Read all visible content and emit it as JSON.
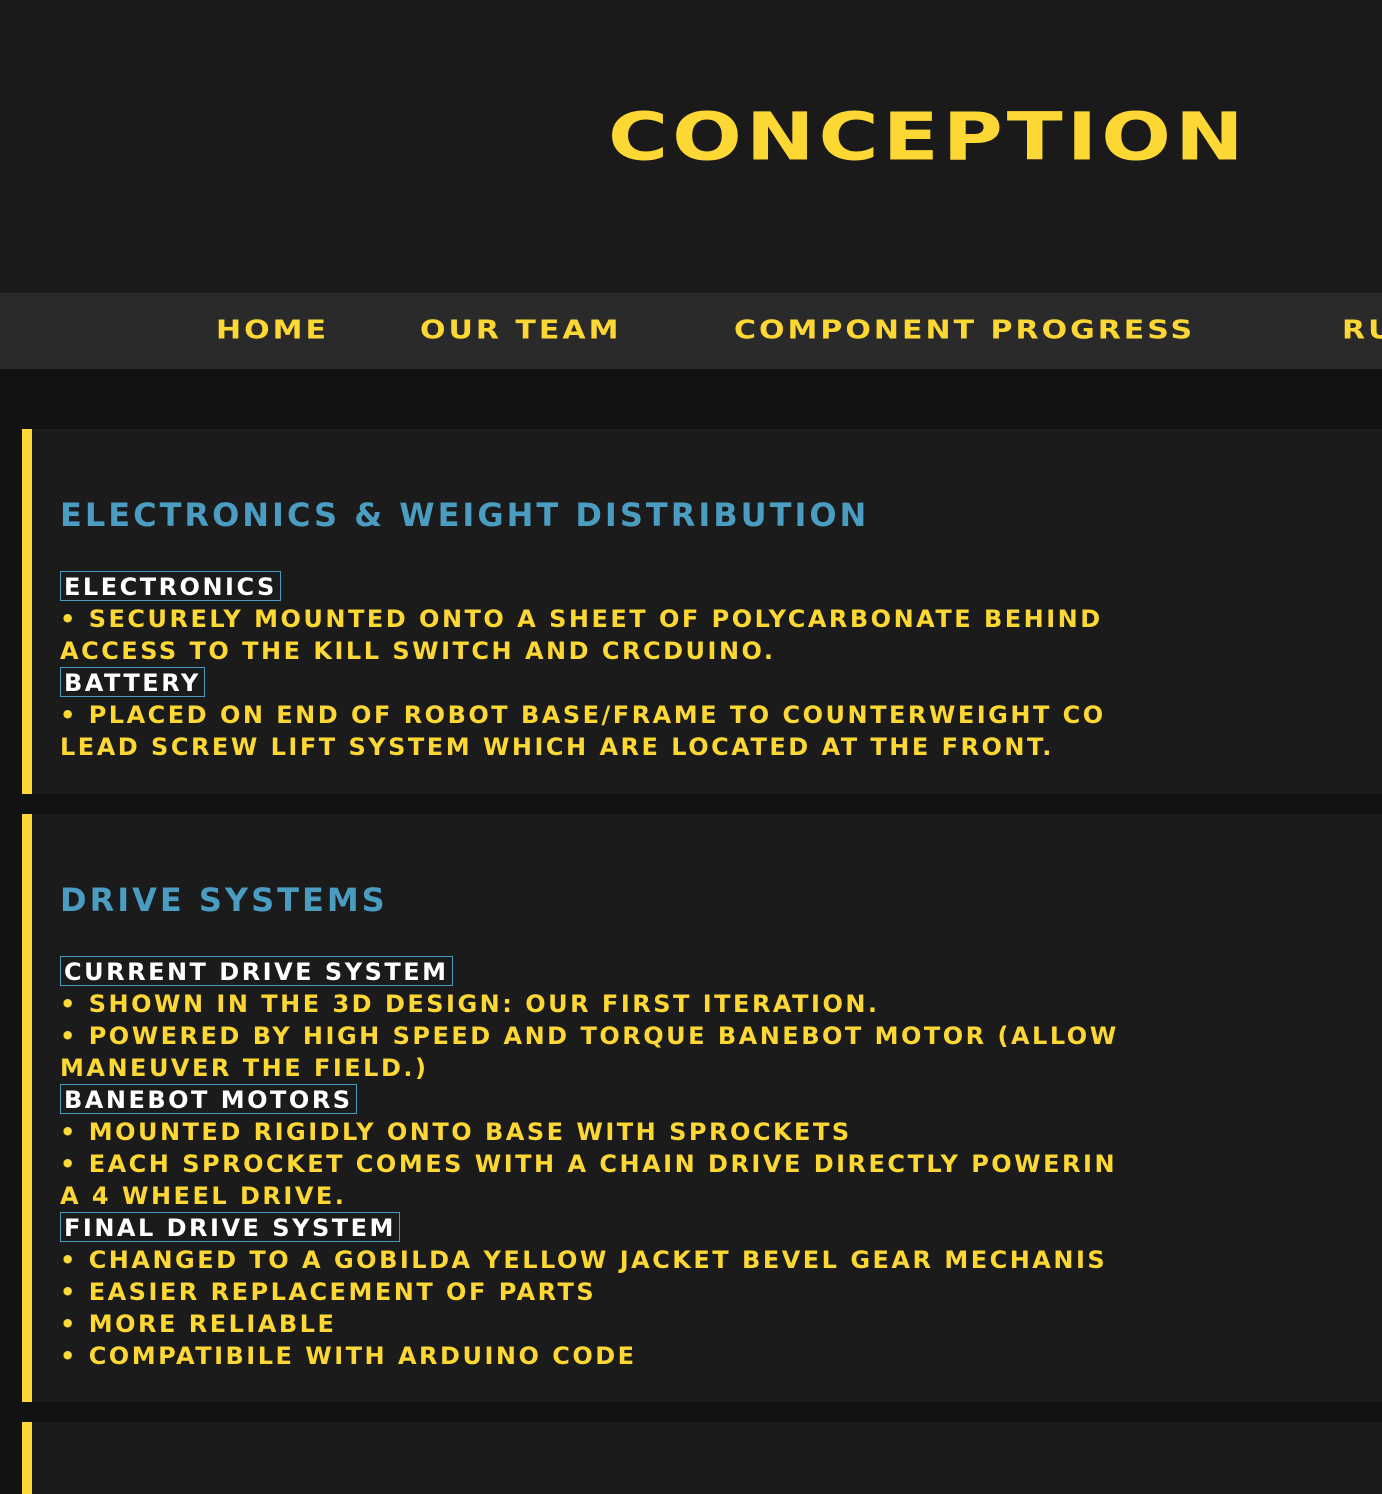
{
  "header": {
    "title": "Conception"
  },
  "nav": {
    "items": [
      {
        "label": "Home"
      },
      {
        "label": "Our Team"
      },
      {
        "label": "Component Progress"
      },
      {
        "label": "Ru"
      }
    ]
  },
  "sections": [
    {
      "title": "Electronics & Weight Distribution",
      "blocks": [
        {
          "label": "Electronics",
          "lines": [
            "• Securely mounted onto a sheet of polycarbonate behind",
            "access to the kill switch and CRCduino."
          ]
        },
        {
          "label": "Battery",
          "lines": [
            "• Placed on end of robot base/frame to counterweight co",
            "lead screw lift system which are located at the front."
          ]
        }
      ]
    },
    {
      "title": "Drive Systems",
      "blocks": [
        {
          "label": "Current Drive System",
          "lines": [
            "• Shown in the 3D design: our first iteration.",
            "• Powered by high speed and torque Banebot motor (allow",
            "maneuver the field.)"
          ]
        },
        {
          "label": "Banebot Motors",
          "lines": [
            "• Mounted rigidly onto base with sprockets",
            "• Each sprocket comes with a chain drive directly powerin",
            "a 4 wheel drive."
          ]
        },
        {
          "label": "Final Drive System",
          "lines": [
            "• Changed to a GoBilda Yellow Jacket Bevel Gear Mechanis",
            "• Easier replacement of parts",
            "• More reliable",
            "• Compatibile with Arduino code"
          ]
        }
      ]
    }
  ],
  "colors": {
    "accent_yellow": "#fdd835",
    "heading_blue": "#4a9cc0",
    "background": "#121212",
    "panel": "#1b1b1b",
    "nav_bar": "#2a2a2a"
  }
}
